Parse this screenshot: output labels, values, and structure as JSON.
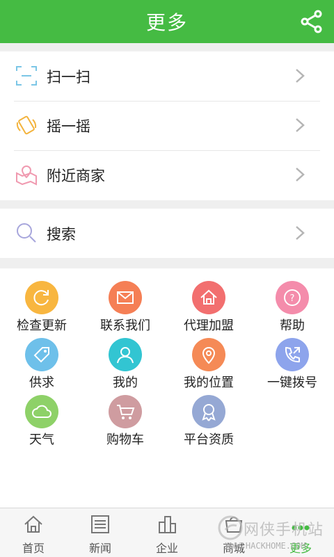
{
  "header": {
    "title": "更多"
  },
  "menu_group_1": [
    {
      "label": "扫一扫",
      "icon": "scan-icon"
    },
    {
      "label": "摇一摇",
      "icon": "shake-phone-icon"
    },
    {
      "label": "附近商家",
      "icon": "nearby-map-icon"
    }
  ],
  "menu_group_2": [
    {
      "label": "搜索",
      "icon": "search-icon"
    }
  ],
  "grid": [
    {
      "label": "检查更新",
      "icon": "refresh-icon",
      "color": "#f8b640"
    },
    {
      "label": "联系我们",
      "icon": "mail-icon",
      "color": "#f57f55"
    },
    {
      "label": "代理加盟",
      "icon": "home-icon",
      "color": "#f26f6f"
    },
    {
      "label": "帮助",
      "icon": "help-icon",
      "color": "#f48cab"
    },
    {
      "label": "供求",
      "icon": "tag-icon",
      "color": "#6ec0ea"
    },
    {
      "label": "我的",
      "icon": "user-icon",
      "color": "#32c5d2"
    },
    {
      "label": "我的位置",
      "icon": "location-pin-icon",
      "color": "#f58a56"
    },
    {
      "label": "一键拨号",
      "icon": "phone-icon",
      "color": "#8da4ec"
    },
    {
      "label": "天气",
      "icon": "cloud-icon",
      "color": "#8ed168"
    },
    {
      "label": "购物车",
      "icon": "cart-icon",
      "color": "#cf9ca0"
    },
    {
      "label": "平台资质",
      "icon": "award-icon",
      "color": "#95a8d4"
    }
  ],
  "tabbar": [
    {
      "label": "首页",
      "icon": "home-tab-icon"
    },
    {
      "label": "新闻",
      "icon": "news-tab-icon"
    },
    {
      "label": "企业",
      "icon": "building-tab-icon"
    },
    {
      "label": "商城",
      "icon": "shop-tab-icon"
    },
    {
      "label": "更多",
      "icon": "more-tab-icon",
      "active": true
    }
  ],
  "watermark": {
    "text": "网侠手机站",
    "url": "WWW.HACKHOME.COM"
  },
  "colors": {
    "accent": "#45bb43",
    "background": "#efefef"
  }
}
